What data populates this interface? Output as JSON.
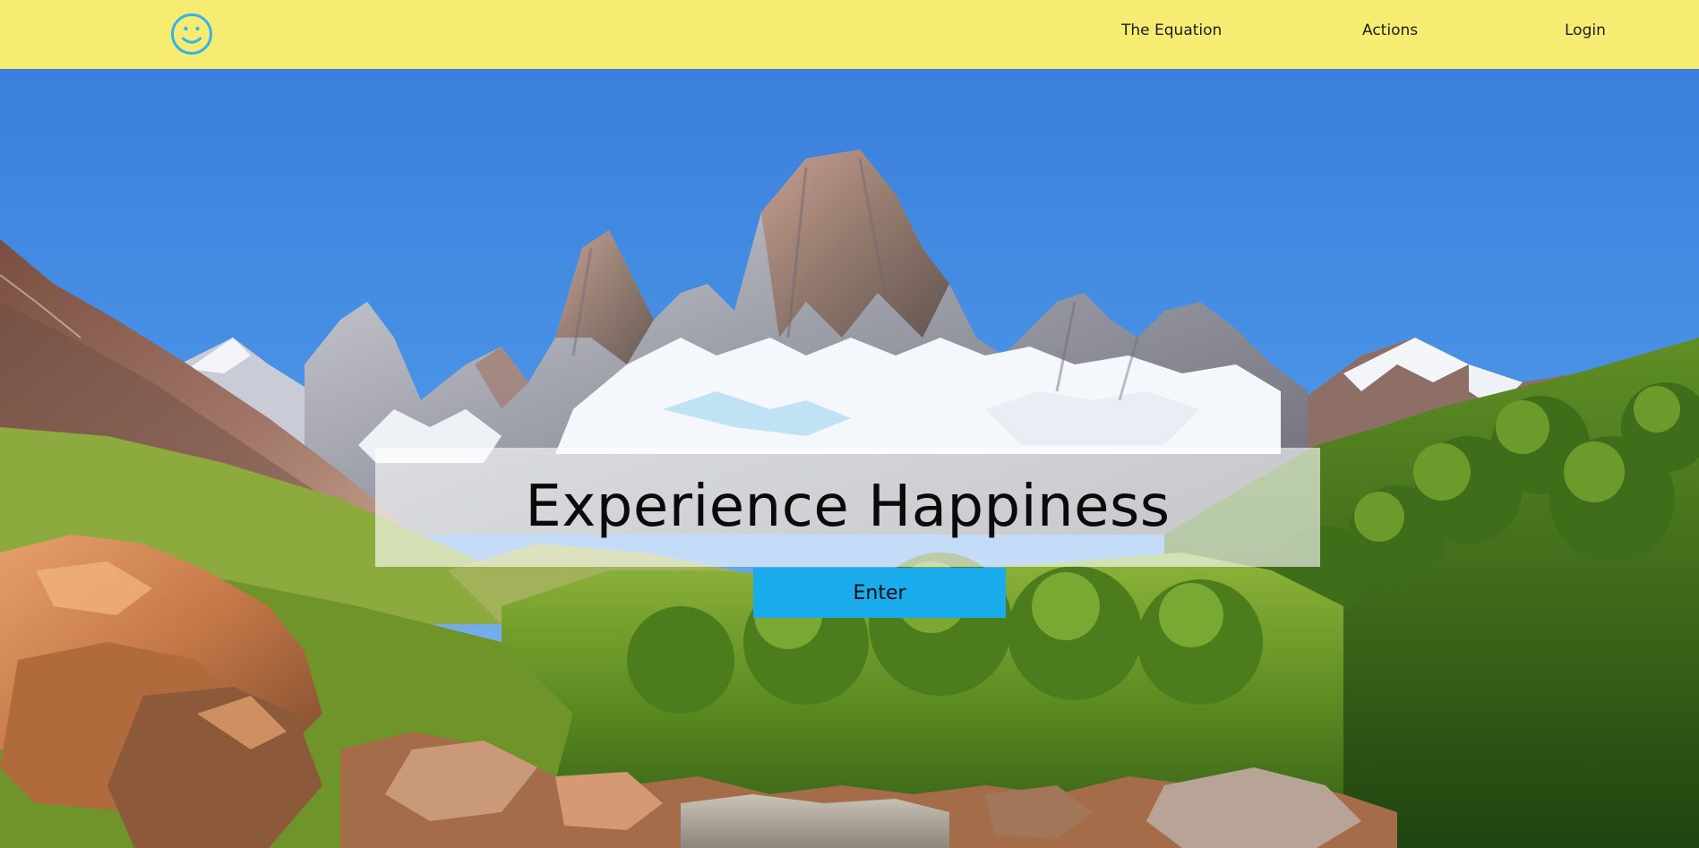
{
  "navbar": {
    "logo_icon": "smiley-face-icon",
    "links": [
      {
        "label": "The Equation"
      },
      {
        "label": "Actions"
      },
      {
        "label": "Login"
      }
    ],
    "background_color": "#f7ec72",
    "logo_color": "#36b3ea"
  },
  "hero": {
    "background_image": "mountain-landscape-photo",
    "headline": "Experience Happiness",
    "cta_label": "Enter",
    "cta_color": "#19abeb"
  }
}
